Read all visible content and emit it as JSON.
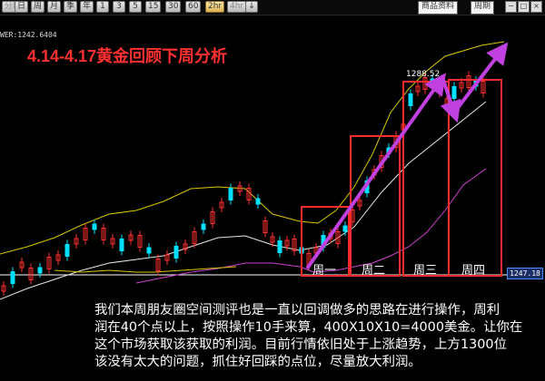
{
  "toolbar": {
    "buttons": [
      {
        "label": "分时",
        "state": "muted"
      },
      {
        "label": "日",
        "state": "normal"
      },
      {
        "label": "周",
        "state": "normal"
      },
      {
        "label": "月",
        "state": "normal"
      },
      {
        "label": "季",
        "state": "normal"
      },
      {
        "label": "年",
        "state": "normal"
      },
      {
        "label": "1",
        "state": "normal"
      },
      {
        "label": "3",
        "state": "normal"
      },
      {
        "label": "5",
        "state": "normal"
      },
      {
        "label": "15",
        "state": "normal"
      },
      {
        "label": "30",
        "state": "normal"
      },
      {
        "label": "60",
        "state": "normal"
      },
      {
        "label": "2hr",
        "state": "active"
      },
      {
        "label": "4hr",
        "state": "muted"
      },
      {
        "label": "↓",
        "state": "normal"
      }
    ],
    "tabs": [
      "商品资料",
      "周期"
    ],
    "window_controls": [
      "−",
      "□",
      "×"
    ]
  },
  "indicator_label": "WER:1242.6404",
  "title": "4.14-4.17黄金回顾下周分析",
  "high_label": "1288.52",
  "price_tag": "1247.18",
  "week_boxes": [
    {
      "label": "周一"
    },
    {
      "label": "周二"
    },
    {
      "label": "周三"
    },
    {
      "label": "周四"
    }
  ],
  "commentary": [
    "我们本周朋友圈空间测评也是一直以回调做多的思路在进行操作，周利",
    "润在40个点以上，按照操作10手来算，400X10X10=4000美金。让你在",
    "这个市场获取该获取的利润。目前行情依旧处于上涨趋势，上方1300位",
    "该没有太大的问题，抓住好回踩的点位，尽量放大利润。"
  ],
  "colors": {
    "bull": "#ff3030",
    "bear": "#00e0ff",
    "upper_band": "#d8c800",
    "mid_line": "#e6e6e6",
    "lower_band": "#d040d0",
    "arrow": "#c040e0",
    "box": "#ff2a2a",
    "title": "#ff3030"
  }
}
